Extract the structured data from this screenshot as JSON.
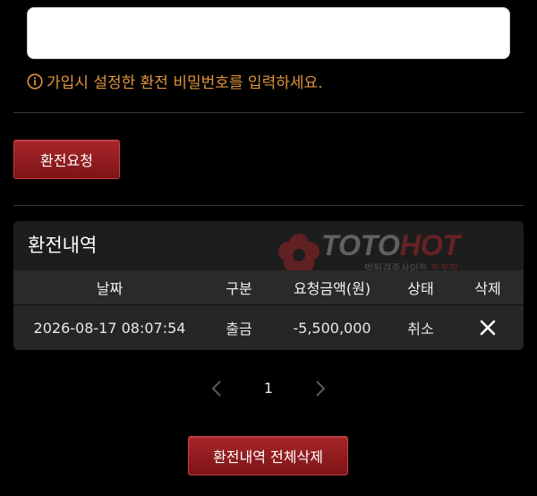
{
  "form": {
    "password_value": "",
    "hint": "가입시 설정한 환전 비밀번호를 입력하세요.",
    "submit_label": "환전요청"
  },
  "history": {
    "title": "환전내역",
    "columns": [
      "날짜",
      "구분",
      "요청금액(원)",
      "상태",
      "삭제"
    ],
    "rows": [
      {
        "date": "2026-08-17 08:07:54",
        "type": "출금",
        "amount": "-5,500,000",
        "status": "취소",
        "delete_icon": "close-icon"
      }
    ]
  },
  "watermark": {
    "brand_a": "TOTO",
    "brand_b": "HOT",
    "tagline_a": "먹튀검증사이트",
    "tagline_b": "토토핫"
  },
  "pagination": {
    "current": "1",
    "prev_icon": "chevron-left-icon",
    "next_icon": "chevron-right-icon"
  },
  "footer": {
    "delete_all_label": "환전내역 전체삭제"
  },
  "colors": {
    "accent_red": "#9a1f22",
    "hint_orange": "#e0943c",
    "panel_bg": "#1d1d1d",
    "header_bg": "#2a2a2a"
  }
}
